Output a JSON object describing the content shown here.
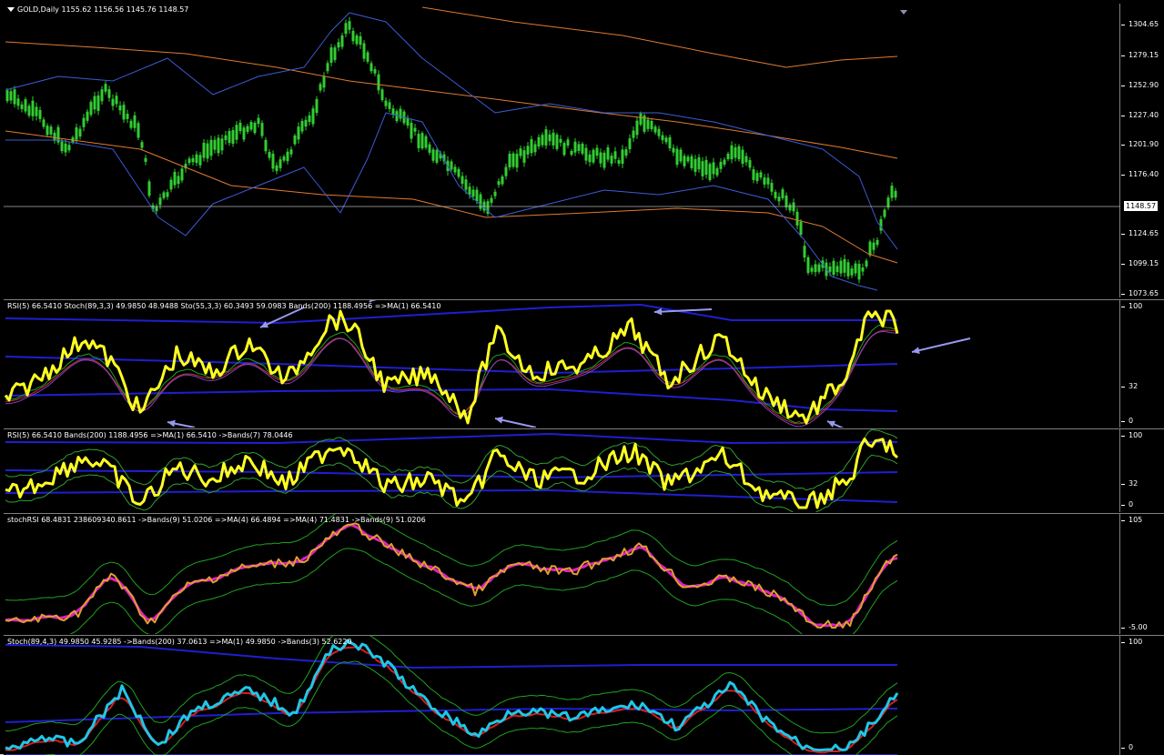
{
  "main": {
    "label": "GOLD,Daily  1155.62 1156.56 1145.76 1148.57",
    "ticks": [
      "1304.65",
      "1279.15",
      "1252.90",
      "1227.40",
      "1201.90",
      "1176.40",
      "1148.57",
      "1124.65",
      "1099.15",
      "1073.65"
    ],
    "current_price": "1148.57"
  },
  "pane1": {
    "label": "RSI(5) 66.5410  Stoch(89,3,3) 49.9850 48.9488  Sto(55,3,3) 60.3493 59.0983  Bands(200) 1188.4956  =>MA(1) 66.5410",
    "ticks": [
      "100",
      "32",
      "0"
    ]
  },
  "pane2": {
    "label": "RSI(5) 66.5410  Bands(200) 1188.4956  =>MA(1) 66.5410  ->Bands(7) 78.0446",
    "ticks": [
      "100",
      "32",
      "0"
    ]
  },
  "pane3": {
    "label": "stochRSI 68.4831 238609340.8611  ->Bands(9) 51.0206  =>MA(4) 66.4894  =>MA(4) 71.4831  ->Bands(9) 51.0206",
    "ticks": [
      "105",
      "-5.00"
    ]
  },
  "pane4": {
    "label": "Stoch(89,4,3) 49.9850 45.9285  ->Bands(200) 37.0613  =>MA(1) 49.9850  ->Bands(3) 52.6220",
    "ticks": [
      "100",
      "0"
    ]
  },
  "colors": {
    "candles": "#32cd32",
    "bands_blue": "#3e5bd6",
    "ma_orange": "#e07a30",
    "rsi_yellow": "#ffff22",
    "band_line": "#1f1fd0",
    "stoch_orange": "#e0a030",
    "stoch_magenta": "#e020c0",
    "stoch_cyan": "#22c6e6",
    "arrow": "#9999ee"
  }
}
